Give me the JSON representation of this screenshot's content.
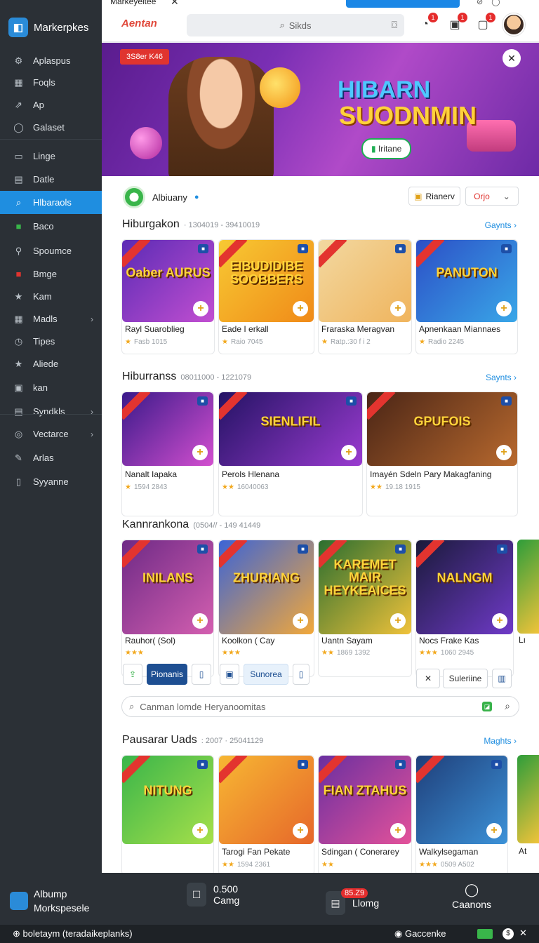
{
  "browser": {
    "tab_title": "Markeyeitee",
    "close_glyph": "✕"
  },
  "sidebar": {
    "brand": "Markerpkes",
    "items": [
      {
        "label": "Aplaspus",
        "icon": "gear-icon",
        "glyph": "⚙"
      },
      {
        "label": "Foqls",
        "icon": "grid-icon",
        "glyph": "▦"
      },
      {
        "label": "Ap",
        "icon": "share-icon",
        "glyph": "⇗"
      },
      {
        "label": "Galaset",
        "icon": "chat-icon",
        "glyph": "◯"
      },
      {
        "label": "Linge",
        "icon": "window-icon",
        "glyph": "▭"
      },
      {
        "label": "Datle",
        "icon": "folder-icon",
        "glyph": "▤"
      },
      {
        "label": "Hlbaraols",
        "icon": "search-icon",
        "glyph": "⌕"
      },
      {
        "label": "Baco",
        "icon": "green-box-icon",
        "glyph": "■"
      },
      {
        "label": "Spoumce",
        "icon": "pin-icon",
        "glyph": "⚲"
      },
      {
        "label": "Bmge",
        "icon": "red-box-icon",
        "glyph": "■"
      },
      {
        "label": "Kam",
        "icon": "star-icon",
        "glyph": "★"
      },
      {
        "label": "Madls",
        "icon": "apps-icon",
        "glyph": "▦",
        "chevron": "›"
      },
      {
        "label": "Tipes",
        "icon": "clock-icon",
        "glyph": "◷"
      },
      {
        "label": "Aliede",
        "icon": "star-icon",
        "glyph": "★"
      },
      {
        "label": "kan",
        "icon": "image-icon",
        "glyph": "▣"
      },
      {
        "label": "Syndkls",
        "icon": "table-icon",
        "glyph": "▤",
        "chevron": "›"
      },
      {
        "label": "Vectarce",
        "icon": "compass-icon",
        "glyph": "◎",
        "chevron": "›"
      },
      {
        "label": "Arlas",
        "icon": "pen-icon",
        "glyph": "✎"
      },
      {
        "label": "Syyanne",
        "icon": "doc-icon",
        "glyph": "▯"
      }
    ]
  },
  "topbar": {
    "logo": "Aentan",
    "search_placeholder": "Sikds",
    "badges": [
      "1",
      "1",
      "1"
    ]
  },
  "hero": {
    "tag": "3S8er K46",
    "title_line1": "HIBARN",
    "title_line2": "SUODNMIN",
    "cta": "Iritane",
    "close_glyph": "✕"
  },
  "store": {
    "name": "Albiuany",
    "verified_glyph": "●",
    "pill_left": "Rianerv",
    "pill_right": "Orjo",
    "sections": [
      {
        "title": "Hiburgakon",
        "range": "· 1304019 - 39410019",
        "more": "Gaynts ›",
        "cards": [
          {
            "thumb": "Oaber AURUS",
            "name": "Rayl Suaroblieg",
            "meta": "Fasb 1015",
            "stars": "★"
          },
          {
            "thumb": "EIBUDIDIBE SOOBBERS",
            "name": "Eade I erkall",
            "meta": "Raio 7045",
            "stars": "★"
          },
          {
            "thumb": "",
            "name": "Fraraska Meragvan",
            "meta": "Ratp.:30 f i 2",
            "stars": "★"
          },
          {
            "thumb": "PANUTON",
            "name": "Apnenkaan Miannaes",
            "meta": "Radio 2245",
            "stars": "★"
          }
        ]
      },
      {
        "title": "Hiburranss",
        "range": "08011000 - 1221079",
        "more": "Saynts ›",
        "cards": [
          {
            "thumb": "",
            "name": "Nanalt Iapaka",
            "meta": "1594 2843",
            "stars": "★"
          },
          {
            "thumb": "SIENLIFIL",
            "name": "Perols Hlenana",
            "meta": "16040063",
            "stars": "★★"
          },
          {
            "thumb": "GPUFOIS",
            "name": "Imayén Sdeln Pary Makagfaning",
            "meta": "19.18 1915",
            "stars": "★★"
          }
        ]
      },
      {
        "title": "Kannrankona",
        "range": "(0504// - 149 41449",
        "more": "",
        "cards": [
          {
            "thumb": "INILANS",
            "name": "Rauhor( (Sol)",
            "meta": "",
            "stars": "★★★"
          },
          {
            "thumb": "ZHURIANG",
            "name": "Koolkon ( Cay",
            "meta": "",
            "stars": "★★★"
          },
          {
            "thumb": "KAREMET MAIR HEYKEAICES",
            "name": "Uantn Sayam",
            "meta": "1869 1392",
            "stars": "★★"
          },
          {
            "thumb": "NALNGM",
            "name": "Nocs Frake Kas",
            "meta": "1060 2945",
            "stars": "★★★"
          }
        ]
      },
      {
        "title": "Pausarar Uads",
        "range": ": 2007 · 25041129",
        "more": "Maghts ›",
        "cards": [
          {
            "thumb": "NITUNG",
            "name": "",
            "meta": "",
            "stars": ""
          },
          {
            "thumb": "",
            "name": "Tarogi Fan Pekate",
            "meta": "1594 2361",
            "stars": "★★"
          },
          {
            "thumb": "FIAN ZTAHUS",
            "name": "Sdingan ( Conerarey",
            "meta": "",
            "stars": "★★"
          },
          {
            "thumb": "",
            "name": "Walkylsegaman",
            "meta": "0509 A502",
            "stars": "★★★"
          }
        ]
      }
    ],
    "peek_label": "Lı",
    "peek_label2": "At",
    "actions": {
      "primary": "Pionanis",
      "soft": "Sunorea",
      "mid": "Suleriine"
    },
    "search2_placeholder": "Canman lomde Heryanoomitas"
  },
  "bottombar": {
    "app_line1": "Albump",
    "app_line2": "Morkspesele",
    "items": [
      {
        "label": "Camg",
        "sub": "0.500"
      },
      {
        "label": "Llomg",
        "badge": "85.Z9"
      },
      {
        "label": "Caanons"
      }
    ]
  },
  "statusbar": {
    "left": "boletaym (teradaikeplanks)",
    "right": "Gaccenke"
  }
}
